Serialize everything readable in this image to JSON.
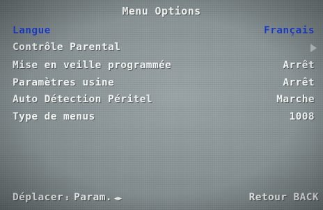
{
  "menu": {
    "title": "Menu Options",
    "items": [
      {
        "label": "Langue",
        "value": "Français",
        "selected": true
      },
      {
        "label": "Contrôle Parental",
        "value": "",
        "has_submenu": true
      },
      {
        "label": "Mise en veille programmée",
        "value": "Arrêt"
      },
      {
        "label": "Paramètres usine",
        "value": "Arrêt"
      },
      {
        "label": "Auto Détection Péritel",
        "value": "Marche"
      },
      {
        "label": "Type de menus",
        "value": "1008"
      }
    ]
  },
  "footer": {
    "move_label": "Déplacer",
    "move_icon": "up-down-arrows-icon",
    "param_label": "Param.",
    "param_icon": "left-right-arrows-icon",
    "back_label": "Retour BACK"
  },
  "colors": {
    "selected_text": "#1c3ec8",
    "normal_text": "#f2f4f4",
    "background": "#8a9496"
  }
}
